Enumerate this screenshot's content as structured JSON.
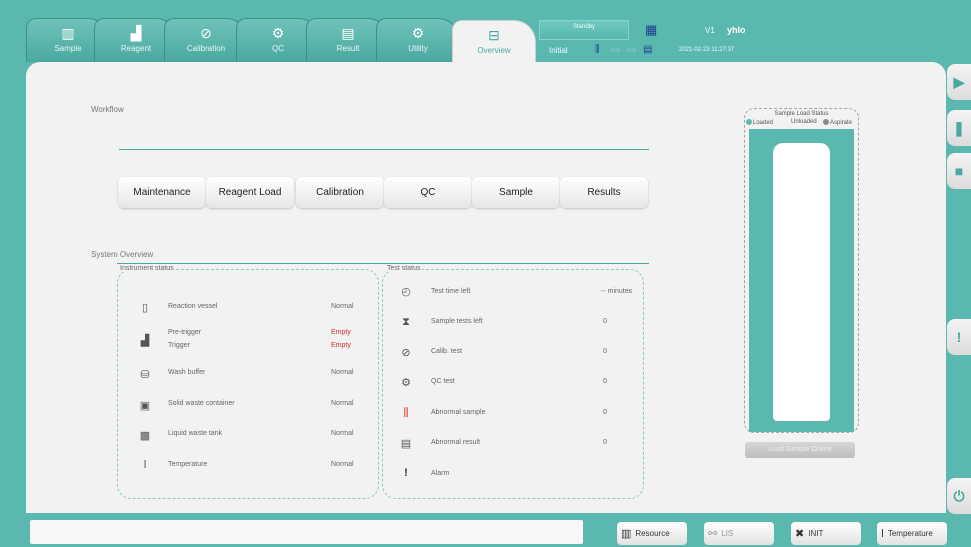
{
  "tabs": [
    {
      "label": "Sample",
      "icon": "sample-icon",
      "glyph": "▥"
    },
    {
      "label": "Reagent",
      "icon": "reagent-icon",
      "glyph": "▟"
    },
    {
      "label": "Calibration",
      "icon": "calibration-icon",
      "glyph": "⊘"
    },
    {
      "label": "QC",
      "icon": "qc-icon",
      "glyph": "⚙"
    },
    {
      "label": "Result",
      "icon": "result-icon",
      "glyph": "▤"
    },
    {
      "label": "Utility",
      "icon": "utility-icon",
      "glyph": "⚙"
    },
    {
      "label": "Overview",
      "icon": "overview-icon",
      "glyph": "⊟"
    }
  ],
  "status": {
    "state": "Standby",
    "mode": "Initial",
    "version": "V1",
    "user": "yhlo",
    "datetime": "2021-02-23 11:27:37"
  },
  "workflow": {
    "title": "Workflow",
    "steps": [
      "Maintenance",
      "Reagent Load",
      "Calibration",
      "QC",
      "Sample",
      "Results"
    ]
  },
  "overview": {
    "title": "System Overview",
    "instrument_title": "Instrument status",
    "instrument": [
      {
        "label": "Reaction vessel",
        "value": "Normal",
        "icon": "reaction-vessel-icon",
        "glyph": "▯"
      },
      {
        "label": "Pre-trigger",
        "value": "Empty",
        "icon": "trigger-icon",
        "glyph": "▟"
      },
      {
        "label": "Trigger",
        "value": "Empty"
      },
      {
        "label": "Wash buffer",
        "value": "Normal",
        "icon": "wash-buffer-icon",
        "glyph": "⛁"
      },
      {
        "label": "Solid waste container",
        "value": "Normal",
        "icon": "solid-waste-icon",
        "glyph": "▣"
      },
      {
        "label": "Liquid waste tank",
        "value": "Normal",
        "icon": "liquid-waste-icon",
        "glyph": "▩"
      },
      {
        "label": "Temperature",
        "value": "Normal",
        "icon": "temperature-icon",
        "glyph": "ǀ"
      }
    ],
    "test_title": "Test status",
    "tests": [
      {
        "label": "Test time left",
        "value": "-- minutes",
        "icon": "clock-icon",
        "glyph": "◴"
      },
      {
        "label": "Sample tests left",
        "value": "0",
        "icon": "hourglass-icon",
        "glyph": "⧗"
      },
      {
        "label": "Calib. test",
        "value": "0",
        "icon": "calibration-icon",
        "glyph": "⊘"
      },
      {
        "label": "QC test",
        "value": "0",
        "icon": "qc-icon",
        "glyph": "⚙"
      },
      {
        "label": "Abnormal sample",
        "value": "0",
        "icon": "abnormal-sample-icon",
        "glyph": "⫼"
      },
      {
        "label": "Abnormal result",
        "value": "0",
        "icon": "abnormal-result-icon",
        "glyph": "▤"
      },
      {
        "label": "Alarm",
        "value": "",
        "icon": "alarm-icon",
        "glyph": "!"
      }
    ]
  },
  "sample_load": {
    "title": "Sample Load Status",
    "legend_loaded": "Loaded",
    "legend_unloaded": "Unloaded",
    "legend_aspirated": "Aspirate",
    "button": "Load Sample Online"
  },
  "bottom": {
    "resource": "Resource",
    "lis": "LIS",
    "init": "INIT",
    "temperature": "Temperature"
  },
  "colors": {
    "accent": "#5ab8ae",
    "alert": "#cc3333",
    "loaded": "#5ab8ae",
    "aspirated": "#888888"
  }
}
